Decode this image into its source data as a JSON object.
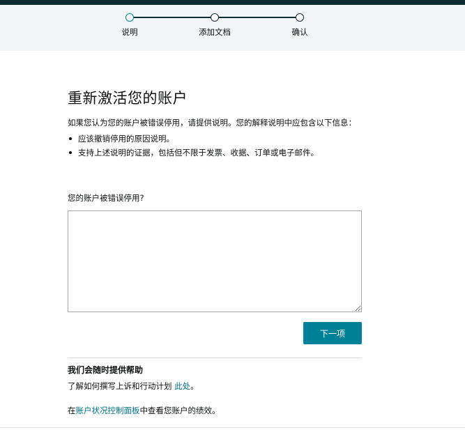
{
  "stepper": {
    "steps": [
      {
        "label": "说明",
        "state": "active"
      },
      {
        "label": "添加文档",
        "state": "pending"
      },
      {
        "label": "确认",
        "state": "pending"
      }
    ]
  },
  "main": {
    "title": "重新激活您的账户",
    "intro": "如果您认为您的账户被错误停用，请提供说明。您的解释说明中应包含以下信息：",
    "bullets": [
      "应该撤销停用的原因说明。",
      "支持上述说明的证据，包括但不限于发票、收据、订单或电子邮件。"
    ],
    "question_label": "您的账户被错误停用?",
    "textarea_value": "",
    "next_label": "下一项"
  },
  "help": {
    "title": "我们会随时提供帮助",
    "line1_prefix": "了解如何撰写上诉和行动计划 ",
    "line1_link": "此处",
    "line1_suffix": "。",
    "line2_prefix": "在",
    "line2_link": "账户状况控制面板",
    "line2_suffix": "中查看您账户的绩效。"
  },
  "colors": {
    "topbar": "#0e2d32",
    "accent": "#008296",
    "link": "#007185"
  }
}
